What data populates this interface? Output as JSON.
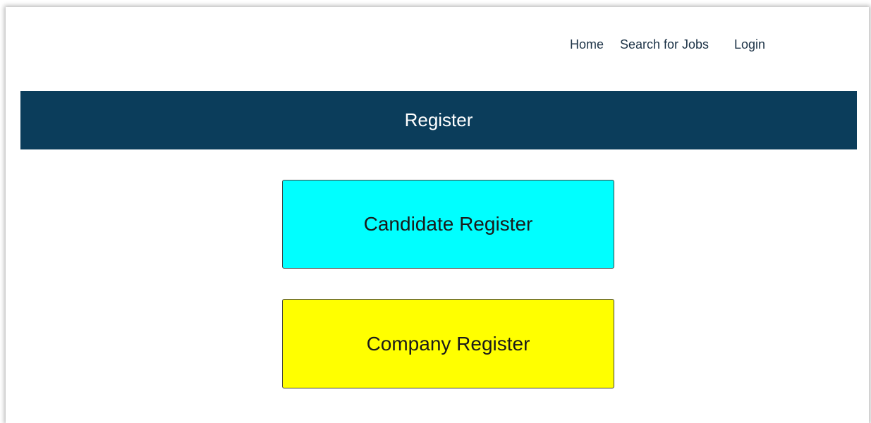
{
  "nav": {
    "home": "Home",
    "search": "Search for Jobs",
    "login": "Login"
  },
  "banner": {
    "title": "Register",
    "color": "#0b3d5b"
  },
  "buttons": {
    "candidate": {
      "label": "Candidate Register",
      "color": "#00ffff"
    },
    "company": {
      "label": "Company Register",
      "color": "#ffff00"
    }
  }
}
